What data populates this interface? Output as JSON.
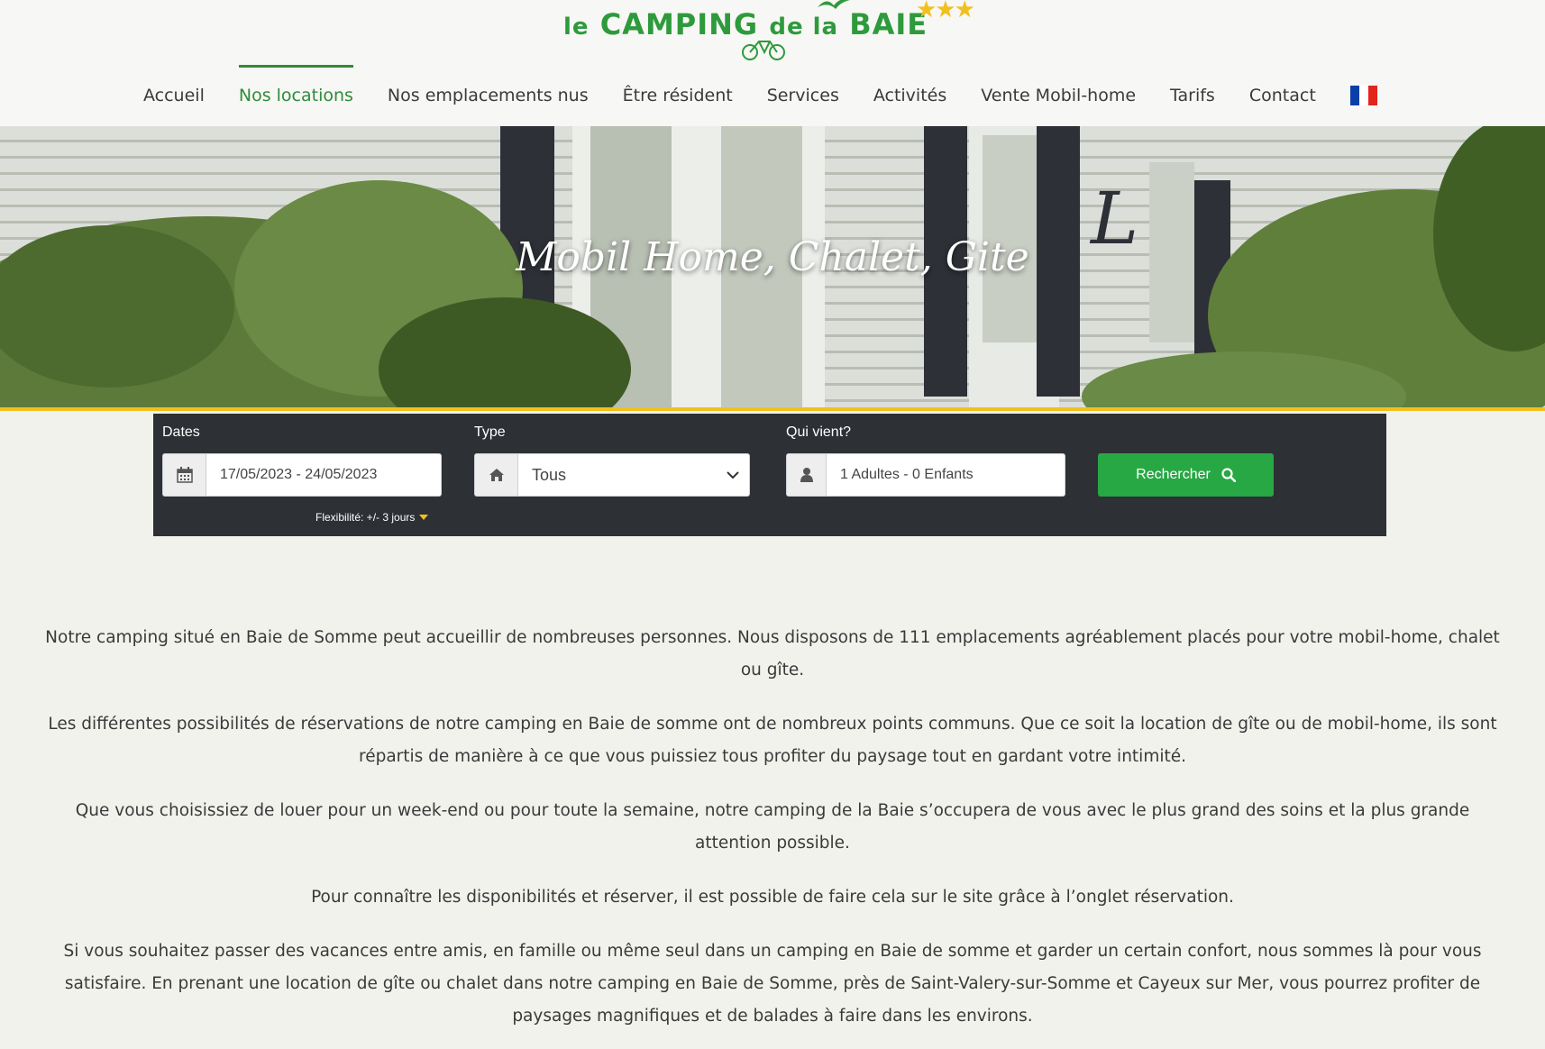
{
  "logo": {
    "text_le": "le",
    "text_camping": "CAMPING",
    "text_de_la": "de la",
    "text_baie": "BAIE",
    "stars": "★★★"
  },
  "nav": {
    "items": [
      {
        "label": "Accueil",
        "active": false
      },
      {
        "label": "Nos locations",
        "active": true
      },
      {
        "label": "Nos emplacements nus",
        "active": false
      },
      {
        "label": "Être résident",
        "active": false
      },
      {
        "label": "Services",
        "active": false
      },
      {
        "label": "Activités",
        "active": false
      },
      {
        "label": "Vente Mobil-home",
        "active": false
      },
      {
        "label": "Tarifs",
        "active": false
      },
      {
        "label": "Contact",
        "active": false
      }
    ],
    "language_flag": "fr-flag-icon",
    "flag_colors": [
      "#0a3fa8",
      "#ffffff",
      "#e1251b"
    ]
  },
  "hero": {
    "title": "Mobil Home, Chalet, Gite"
  },
  "search": {
    "dates_label": "Dates",
    "dates_value": "17/05/2023 - 24/05/2023",
    "flexibility": "Flexibilité: +/- 3 jours",
    "type_label": "Type",
    "type_value": "Tous",
    "guests_label": "Qui vient?",
    "guests_value": "1 Adultes - 0 Enfants",
    "button_label": "Rechercher"
  },
  "colors": {
    "accent_green": "#2e8b3a",
    "button_green": "#27a844",
    "search_bg": "#2d3035",
    "hero_line": "#f2c01e"
  },
  "content": {
    "paragraphs": [
      "Notre camping situé en Baie de Somme peut accueillir de nombreuses personnes. Nous disposons de 111 emplacements agréablement placés pour votre mobil-home, chalet ou gîte.",
      "Les différentes possibilités de réservations de notre camping en Baie de somme ont de nombreux points communs. Que ce soit la location de gîte ou de mobil-home, ils sont répartis de manière à ce que vous puissiez tous profiter du paysage tout en gardant votre intimité.",
      "Que vous choisissiez de louer pour un week-end ou pour toute la semaine, notre camping de la Baie s’occupera de vous avec le plus grand des soins et la plus grande attention possible.",
      "Pour connaître les disponibilités et réserver, il est possible de faire cela sur le site grâce à l’onglet réservation.",
      "Si vous souhaitez passer des vacances entre amis, en famille ou même seul dans un camping en Baie de somme et garder un certain confort, nous sommes là pour vous satisfaire. En prenant une location de gîte ou chalet dans notre camping en Baie de Somme, près de Saint-Valery-sur-Somme et Cayeux sur Mer, vous pourrez profiter de paysages magnifiques et de balades à faire dans les environs."
    ]
  }
}
